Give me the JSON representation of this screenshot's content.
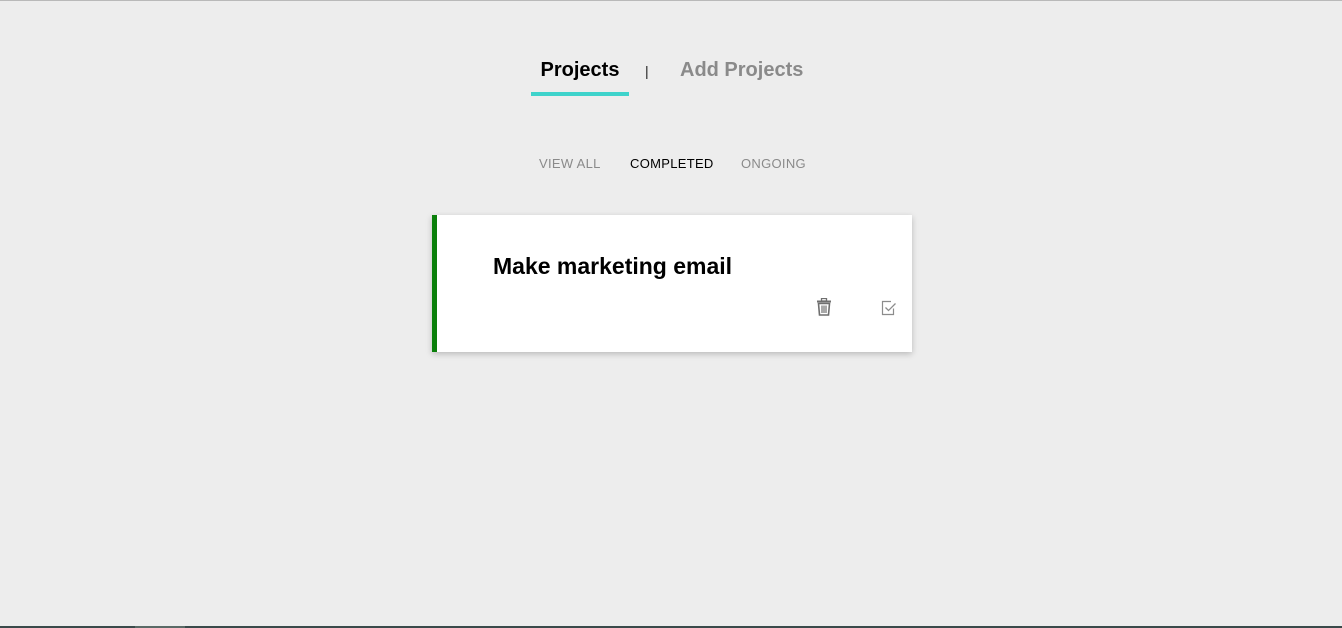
{
  "nav": {
    "tabs": [
      {
        "label": "Projects",
        "active": true
      },
      {
        "label": "Add Projects",
        "active": false
      }
    ],
    "separator": "|"
  },
  "filters": [
    {
      "label": "VIEW ALL",
      "active": false
    },
    {
      "label": "COMPLETED",
      "active": true
    },
    {
      "label": "ONGOING",
      "active": false
    }
  ],
  "projects": [
    {
      "title": "Make marketing email",
      "status_color": "#0a7f0a",
      "actions": [
        {
          "icon": "trash-icon"
        },
        {
          "icon": "checkbox-checked-icon"
        }
      ]
    }
  ],
  "colors": {
    "accent": "#3ed3cb",
    "background": "#ededed",
    "inactive_text": "#8a8a8a",
    "completed_border": "#0a7f0a"
  }
}
